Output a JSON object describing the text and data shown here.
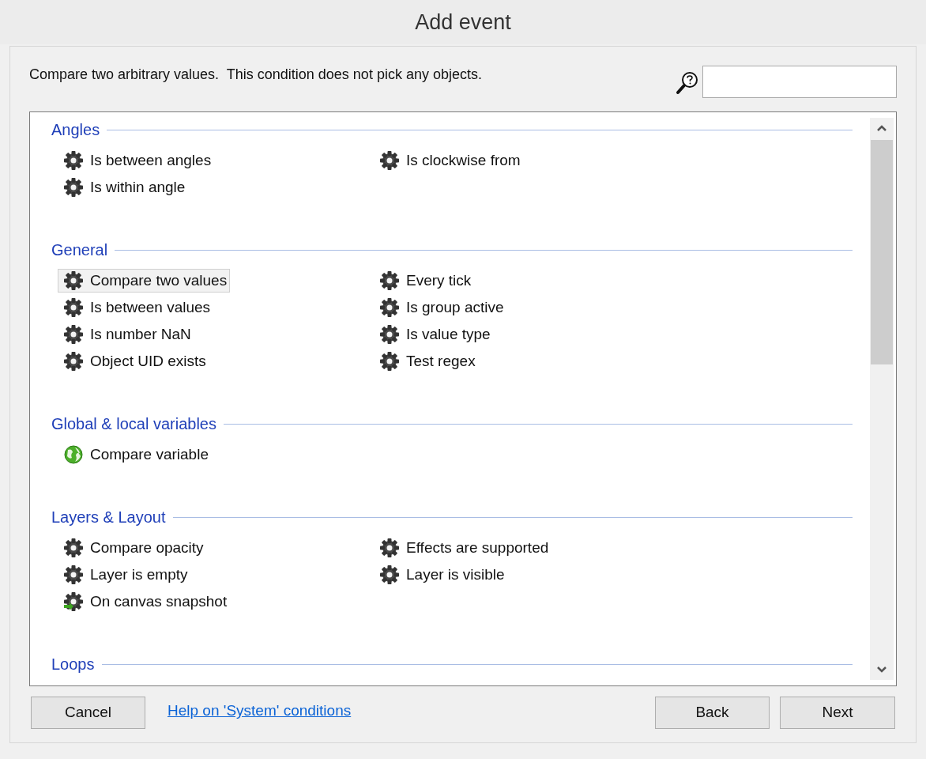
{
  "window": {
    "title": "Add event"
  },
  "description": "Compare two arbitrary values.  This condition does not pick any objects.",
  "sections": [
    {
      "heading": "Angles",
      "columns": [
        [
          {
            "label": "Is between angles",
            "kind": "gear",
            "selected": false
          },
          {
            "label": "Is within angle",
            "kind": "gear",
            "selected": false
          }
        ],
        [
          {
            "label": "Is clockwise from",
            "kind": "gear",
            "selected": false
          }
        ]
      ]
    },
    {
      "heading": "General",
      "columns": [
        [
          {
            "label": "Compare two values",
            "kind": "gear",
            "selected": true
          },
          {
            "label": "Is between values",
            "kind": "gear",
            "selected": false
          },
          {
            "label": "Is number NaN",
            "kind": "gear",
            "selected": false
          },
          {
            "label": "Object UID exists",
            "kind": "gear",
            "selected": false
          }
        ],
        [
          {
            "label": "Every tick",
            "kind": "gear",
            "selected": false
          },
          {
            "label": "Is group active",
            "kind": "gear",
            "selected": false
          },
          {
            "label": "Is value type",
            "kind": "gear",
            "selected": false
          },
          {
            "label": "Test regex",
            "kind": "gear",
            "selected": false
          }
        ]
      ]
    },
    {
      "heading": "Global & local variables",
      "columns": [
        [
          {
            "label": "Compare variable",
            "kind": "globe",
            "selected": false
          }
        ],
        []
      ]
    },
    {
      "heading": "Layers & Layout",
      "columns": [
        [
          {
            "label": "Compare opacity",
            "kind": "gear",
            "selected": false
          },
          {
            "label": "Layer is empty",
            "kind": "gear",
            "selected": false
          },
          {
            "label": "On canvas snapshot",
            "kind": "trigger",
            "selected": false
          }
        ],
        [
          {
            "label": "Effects are supported",
            "kind": "gear",
            "selected": false
          },
          {
            "label": "Layer is visible",
            "kind": "gear",
            "selected": false
          }
        ]
      ]
    },
    {
      "heading": "Loops",
      "columns": [
        [],
        []
      ]
    }
  ],
  "buttons": {
    "cancel": "Cancel",
    "help_link": "Help on 'System' conditions",
    "back": "Back",
    "next": "Next"
  }
}
